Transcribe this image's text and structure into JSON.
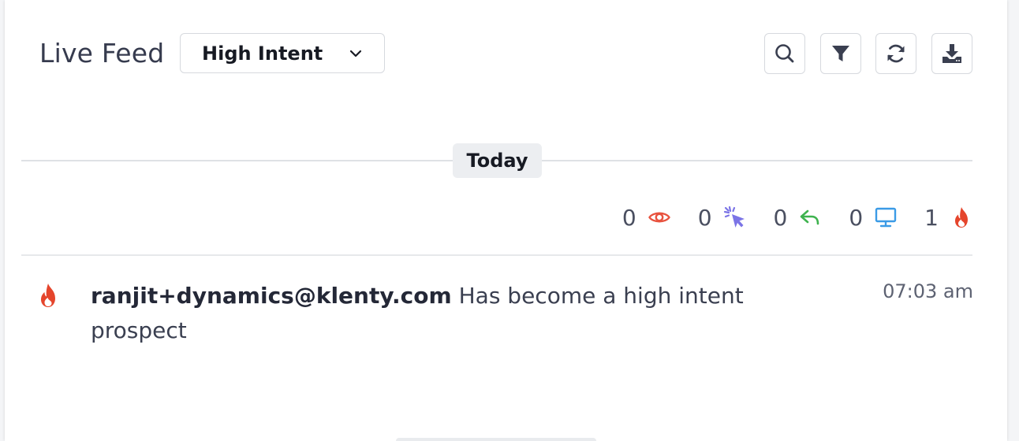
{
  "header": {
    "title": "Live Feed",
    "filter_select": {
      "value": "High Intent",
      "icon": "chevron-down-icon"
    },
    "tools": [
      {
        "name": "search",
        "icon": "search-icon"
      },
      {
        "name": "filter",
        "icon": "filter-icon"
      },
      {
        "name": "refresh",
        "icon": "refresh-icon"
      },
      {
        "name": "download",
        "icon": "download-icon"
      }
    ]
  },
  "date_divider": {
    "label": "Today"
  },
  "stats": [
    {
      "type": "opens",
      "count": "0",
      "icon": "eye-icon",
      "color": "#e8533f"
    },
    {
      "type": "clicks",
      "count": "0",
      "icon": "cursor-click-icon",
      "color": "#7b74e6"
    },
    {
      "type": "replies",
      "count": "0",
      "icon": "reply-icon",
      "color": "#3fb34f"
    },
    {
      "type": "website-visits",
      "count": "0",
      "icon": "monitor-icon",
      "color": "#3b9be6"
    },
    {
      "type": "high-intent",
      "count": "1",
      "icon": "fire-icon",
      "color": "#e5452c"
    }
  ],
  "feed": [
    {
      "icon": "fire-icon",
      "email": "ranjit+dynamics@klenty.com",
      "message": " Has become a high intent prospect",
      "time": "07:03 am"
    }
  ],
  "colors": {
    "text_primary": "#363b4e",
    "border": "#d6d9de",
    "fire": "#e5452c"
  }
}
